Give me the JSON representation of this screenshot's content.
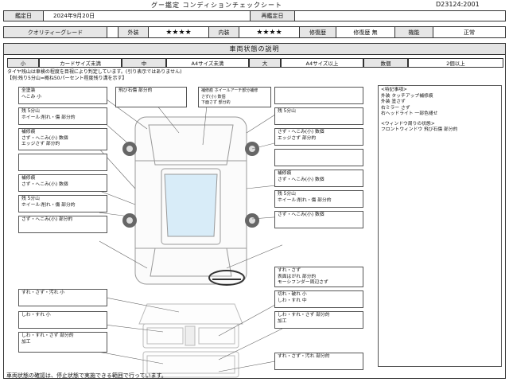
{
  "header": {
    "title": "グー鑑定 コンディションチェックシート",
    "sheet_id": "D23124:2001"
  },
  "dates": {
    "inspect_label": "鑑定日",
    "inspect_value": "2024年9月20日",
    "reinspect_label": "再鑑定日",
    "reinspect_value": ""
  },
  "grades": {
    "quality_label": "クオリティーグレード",
    "quality_value": "",
    "exterior_label": "外装",
    "exterior_value": "★★★★",
    "interior_label": "内装",
    "interior_value": "★★★★",
    "repair_label": "修復歴",
    "repair_value": "修復歴 無",
    "function_label": "機能",
    "function_value": "正常"
  },
  "section_title": "車両状態の説明",
  "legend": [
    {
      "size": "小",
      "desc": "カードサイズ未満"
    },
    {
      "size": "中",
      "desc": "A4サイズ未満"
    },
    {
      "size": "大",
      "desc": "A4サイズ以上"
    },
    {
      "size": "数個",
      "desc": "2個以上"
    }
  ],
  "notes": {
    "line1": "タイヤ残山は車検の程度を目視により判定しています。(引り表示ではありません)",
    "line2": "【例:残り5分山=概ね50パーセント程度残り溝を示す】"
  },
  "damage": {
    "left_1": "全塗装\nへこみ 小",
    "left_2": "残 5分山\nホイール:削れ・傷 部分的",
    "left_3": "補修痕\nさず・へこみ(小) 数個\nエッジさず 部分的",
    "left_4": "",
    "left_5": "補修痕\nさず・へこみ(小) 数個",
    "left_6": "残 5分山\nホイール:削れ・傷 部分的",
    "left_7": "さず・へこみ(小) 部分的",
    "top_1": "飛び石傷 部分的",
    "top_2": "補修痕 ホイールアーチ部分補修\nさず(小) 数個\n下面さず 部分的",
    "right_1": "",
    "right_2": "残 5分山",
    "right_3": "さず・へこみ(小) 数個\nエッジさず 部分的",
    "right_4": "",
    "right_5": "補修痕\nさず・へこみ(小) 数個",
    "right_6": "残 5分山\nホイール:削れ・傷 部分的",
    "right_7": "さず・へこみ(小) 数個",
    "steering": "すれ・さず\n表面はがれ 部分的\nモーシフンダー周辺さず",
    "int_left_1": "すれ・さず・汚れ 小",
    "int_left_2": "しわ・すれ 小",
    "int_left_3": "しわ・すれ・さず 部分的\n加工",
    "int_right_1": "切れ・破れ 小\nしわ・すれ 中",
    "int_right_2": "しわ・すれ・さず 部分的\n加工",
    "int_right_3": "すれ・さず・汚れ 部分的"
  },
  "special": {
    "title": "<特記事項>",
    "lines": [
      "外装 タッチアップ補修痕",
      "外装 塗さず",
      "右ミラー さず",
      "右ヘッドライト 一部色褪せ"
    ],
    "glass_title": "<ウィンドウ周りの状態>",
    "glass_lines": [
      "フロントウィンドウ 飛び石傷 部分的"
    ]
  },
  "footer": "車両状態の確認は、停止状態で実施できる範囲で行っています。"
}
